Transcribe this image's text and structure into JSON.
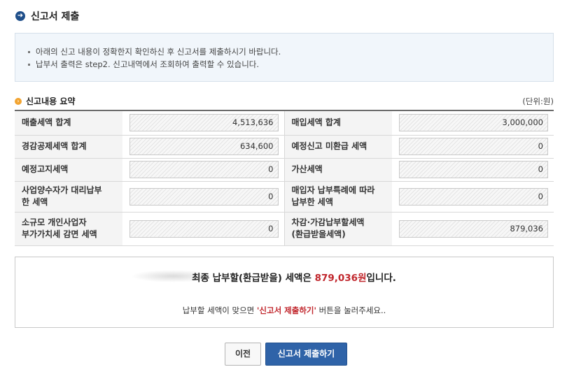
{
  "page": {
    "title": "신고서 제출",
    "title_icon": "arrow-right-circle-icon"
  },
  "notice": {
    "lines": [
      "아래의 신고 내용이 정확한지 확인하신 후 신고서를 제출하시기 바랍니다.",
      "납부서 출력은 step2. 신고내역에서 조회하여 출력할 수 있습니다."
    ]
  },
  "summary": {
    "title": "신고내용 요약",
    "unit": "(단위:원)",
    "rows": [
      [
        {
          "label": "매출세액 합계",
          "value": "4,513,636"
        },
        {
          "label": "매입세액 합계",
          "value": "3,000,000"
        }
      ],
      [
        {
          "label": "경감공제세액 합계",
          "value": "634,600"
        },
        {
          "label": "예정신고 미환급 세액",
          "value": "0"
        }
      ],
      [
        {
          "label": "예정고지세액",
          "value": "0"
        },
        {
          "label": "가산세액",
          "value": "0"
        }
      ],
      [
        {
          "label": "사업양수자가 대리납부\n한 세액",
          "value": "0"
        },
        {
          "label": "매입자 납부특례에 따라\n납부한 세액",
          "value": "0"
        }
      ],
      [
        {
          "label": "소규모 개인사업자\n부가가치세 감면 세액",
          "value": "0"
        },
        {
          "label": "차감·가감납부할세액\n(환급받을세액)",
          "value": "879,036"
        }
      ]
    ]
  },
  "final": {
    "prefix": "최종 납부할(환급받을) 세액은 ",
    "amount": "879,036원",
    "suffix": "입니다.",
    "sub_prefix": "납부할 세액이 맞으면 ",
    "sub_highlight": "'신고서 제출하기'",
    "sub_suffix": " 버튼을 눌러주세요.."
  },
  "buttons": {
    "prev": "이전",
    "submit": "신고서 제출하기"
  },
  "colors": {
    "accent_blue": "#2f63a8",
    "highlight_red": "#c1272d",
    "section_dot": "#f2a431"
  }
}
